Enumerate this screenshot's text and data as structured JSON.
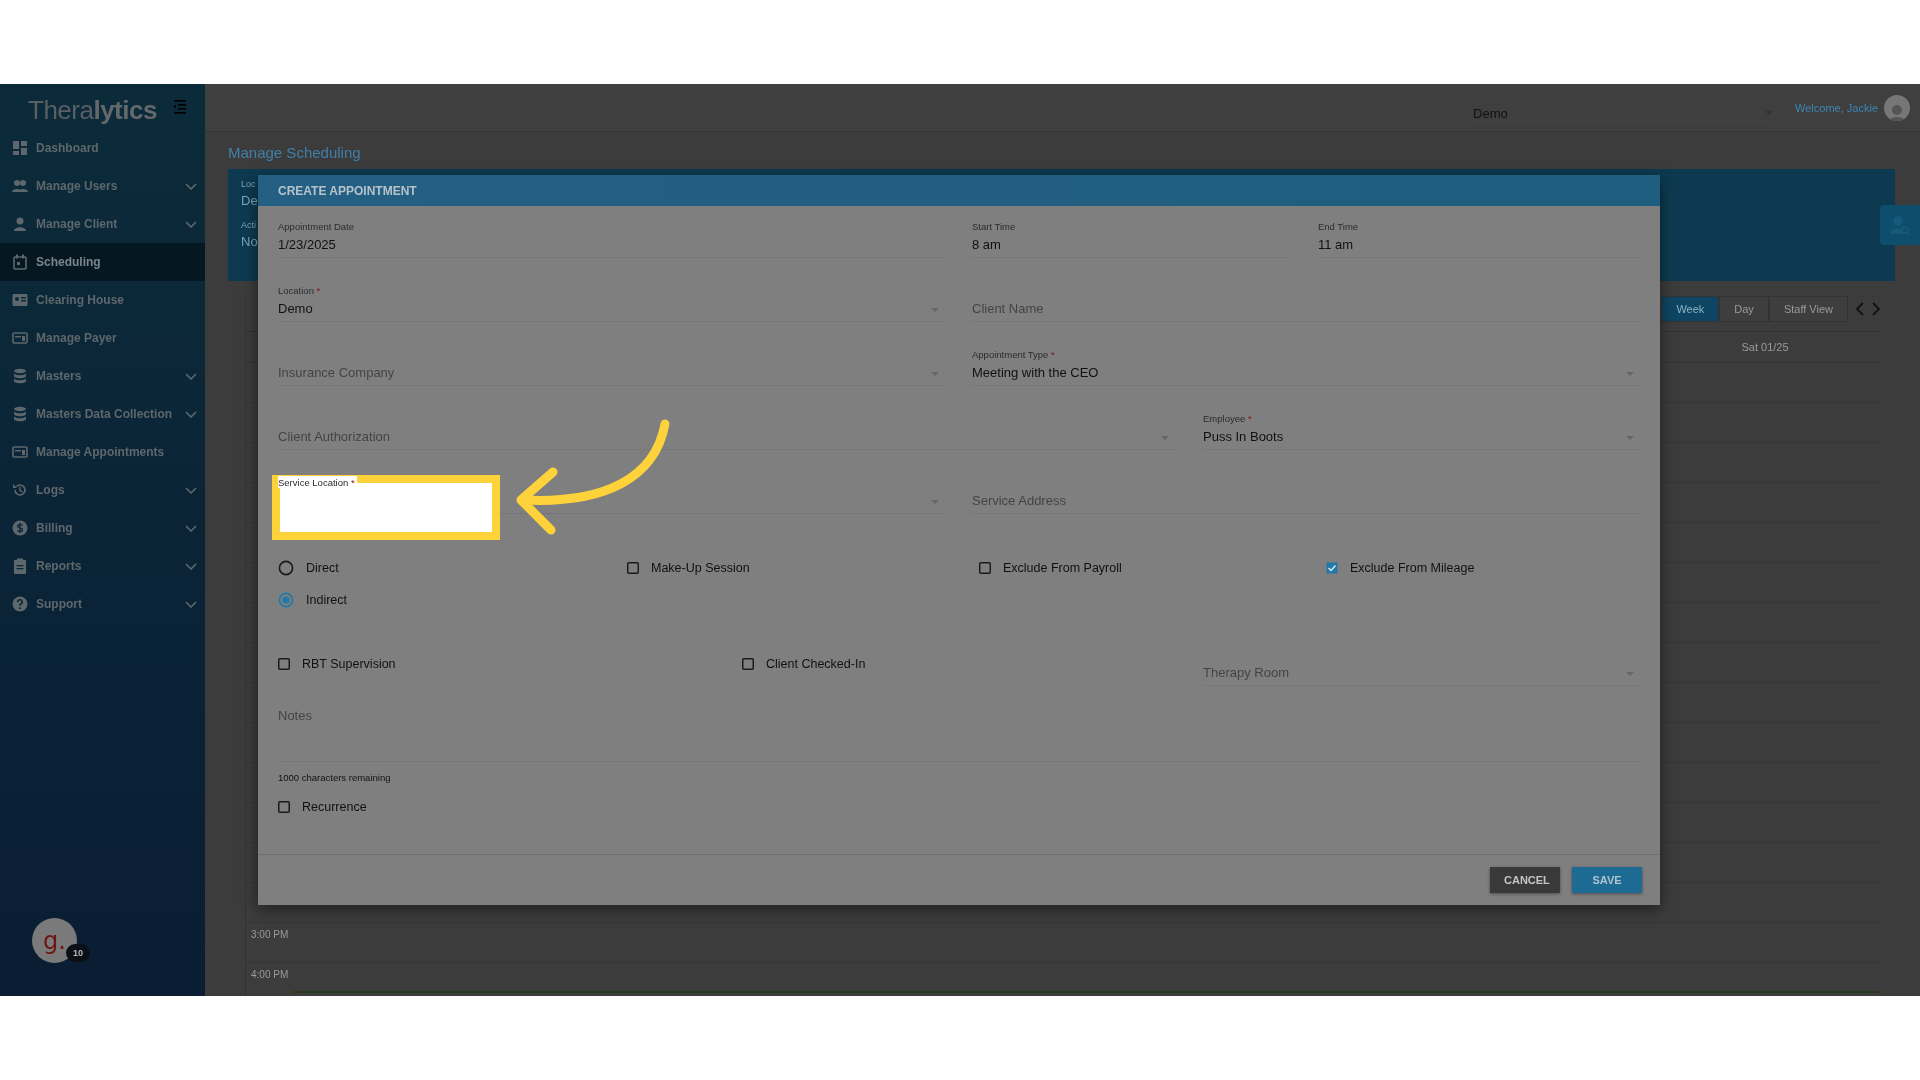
{
  "sidebar": {
    "logo": "Thera**lytics**",
    "items": [
      {
        "label": "Dashboard",
        "expandable": false,
        "selected": false
      },
      {
        "label": "Manage Users",
        "expandable": true,
        "selected": false
      },
      {
        "label": "Manage Client",
        "expandable": true,
        "selected": false
      },
      {
        "label": "Scheduling",
        "expandable": false,
        "selected": true
      },
      {
        "label": "Clearing House",
        "expandable": false,
        "selected": false
      },
      {
        "label": "Manage Payer",
        "expandable": false,
        "selected": false
      },
      {
        "label": "Masters",
        "expandable": true,
        "selected": false
      },
      {
        "label": "Masters Data Collection",
        "expandable": true,
        "selected": false
      },
      {
        "label": "Manage Appointments",
        "expandable": false,
        "selected": false
      },
      {
        "label": "Logs",
        "expandable": true,
        "selected": false
      },
      {
        "label": "Billing",
        "expandable": true,
        "selected": false
      },
      {
        "label": "Reports",
        "expandable": true,
        "selected": false
      },
      {
        "label": "Support",
        "expandable": true,
        "selected": false
      }
    ],
    "helper": {
      "logo": "g.",
      "count": "10"
    }
  },
  "header": {
    "location": "Demo",
    "welcome": "Welcome, Jackie"
  },
  "page": {
    "title": "Manage Scheduling",
    "filter_texts": [
      "Loc",
      "De",
      "Acti",
      "No"
    ],
    "calendar": {
      "views": [
        {
          "label": "Week",
          "selected": true
        },
        {
          "label": "Day",
          "selected": false
        },
        {
          "label": "Staff View",
          "selected": false
        }
      ],
      "day_header": "Sat 01/25",
      "times": [
        "3:00 PM",
        "4:00 PM"
      ]
    }
  },
  "modal": {
    "title": "CREATE APPOINTMENT",
    "fields": [
      {
        "label": "Appointment Date",
        "value": "1/23/2025",
        "dropdown": false
      },
      {
        "label": "Start Time",
        "value": "8 am",
        "dropdown": false
      },
      {
        "label": "End Time",
        "value": "11 am",
        "dropdown": false
      },
      {
        "label": "Location",
        "required_mark": "*",
        "value": "Demo",
        "dropdown": true
      },
      {
        "placeholder": "Client Name",
        "dropdown": false
      },
      {
        "placeholder": "Insurance Company",
        "dropdown": true
      },
      {
        "label": "Appointment Type",
        "required_mark": "*",
        "value": "Meeting with the CEO",
        "dropdown": true
      },
      {
        "placeholder": "Client Authorization",
        "dropdown": true
      },
      {
        "label": "Employee",
        "required_mark": "*",
        "value": "Puss In Boots",
        "dropdown": true
      },
      {
        "label": "Service Location",
        "required_mark": "*",
        "dropdown": true,
        "highlighted": true
      },
      {
        "placeholder": "Service Address",
        "dropdown": false
      }
    ],
    "visit_types": [
      {
        "label": "Direct",
        "selected": false
      },
      {
        "label": "Indirect",
        "selected": true
      }
    ],
    "options": [
      {
        "label": "Make-Up Session",
        "checked": false
      },
      {
        "label": "Exclude From Payroll",
        "checked": false
      },
      {
        "label": "Exclude From Mileage",
        "checked": true
      }
    ],
    "options_2": [
      {
        "label": "RBT Supervision",
        "checked": false
      },
      {
        "label": "Client Checked-In",
        "checked": false
      }
    ],
    "therapy_room": {
      "placeholder": "Therapy Room"
    },
    "notes": {
      "placeholder": "Notes"
    },
    "notes_counter": "1000 characters remaining",
    "recurrence": {
      "label": "Recurrence",
      "checked": false
    },
    "buttons": [
      {
        "label": "CANCEL",
        "kind": "secondary"
      },
      {
        "label": "SAVE",
        "kind": "primary"
      }
    ]
  }
}
